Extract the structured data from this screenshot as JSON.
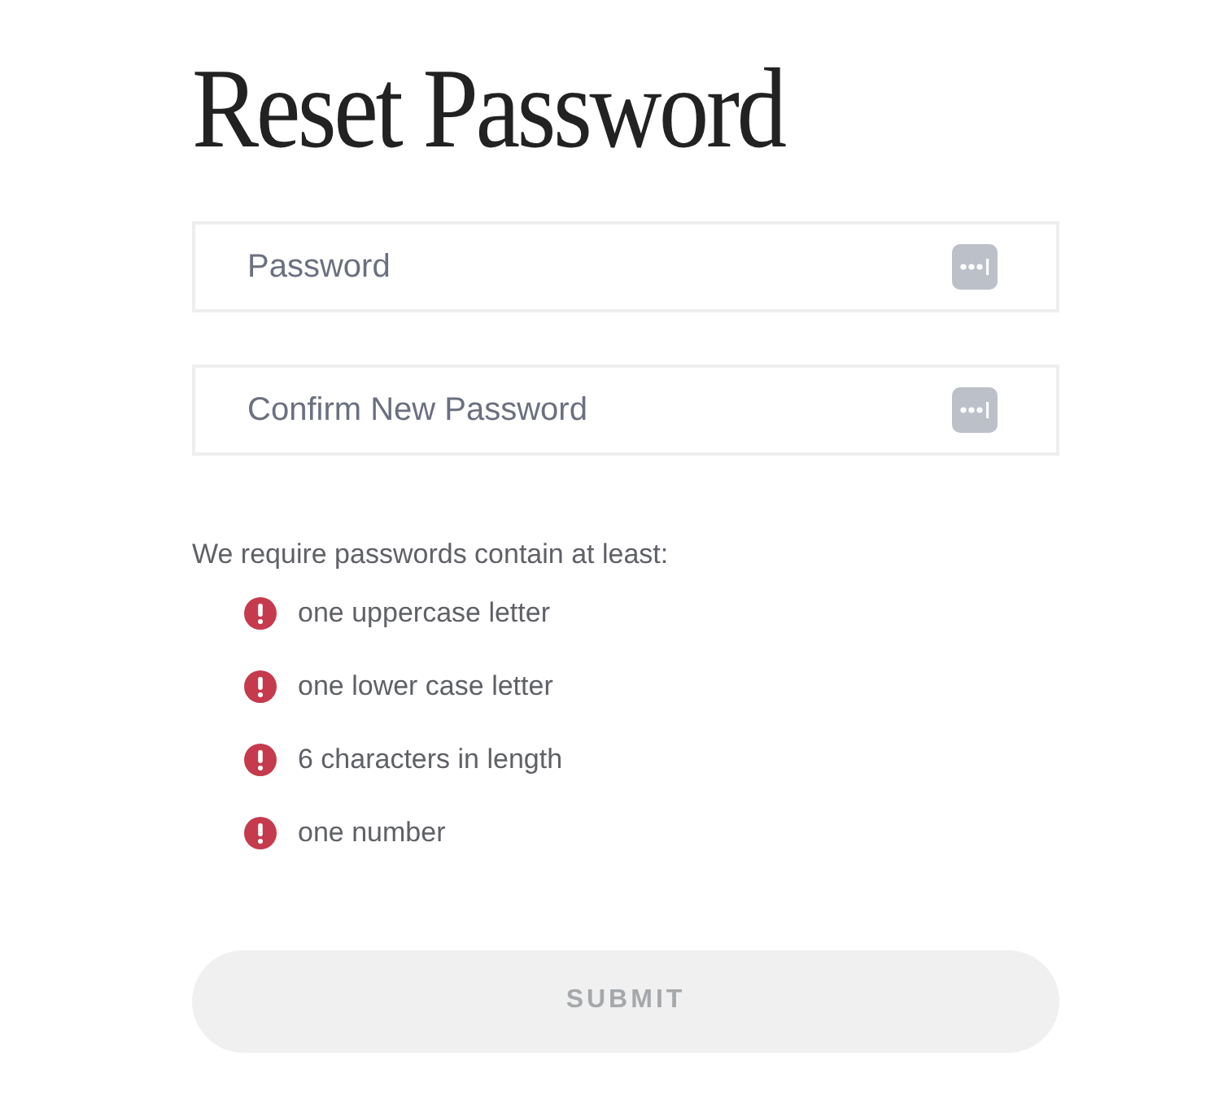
{
  "title": "Reset Password",
  "fields": [
    {
      "placeholder": "Password"
    },
    {
      "placeholder": "Confirm New Password"
    }
  ],
  "requirements_intro": "We require passwords contain at least:",
  "requirements": [
    {
      "text": "one uppercase letter",
      "met": false
    },
    {
      "text": "one lower case letter",
      "met": false
    },
    {
      "text": "6 characters in length",
      "met": false
    },
    {
      "text": "one number",
      "met": false
    }
  ],
  "submit": {
    "label": "SUBMIT",
    "disabled": true
  }
}
